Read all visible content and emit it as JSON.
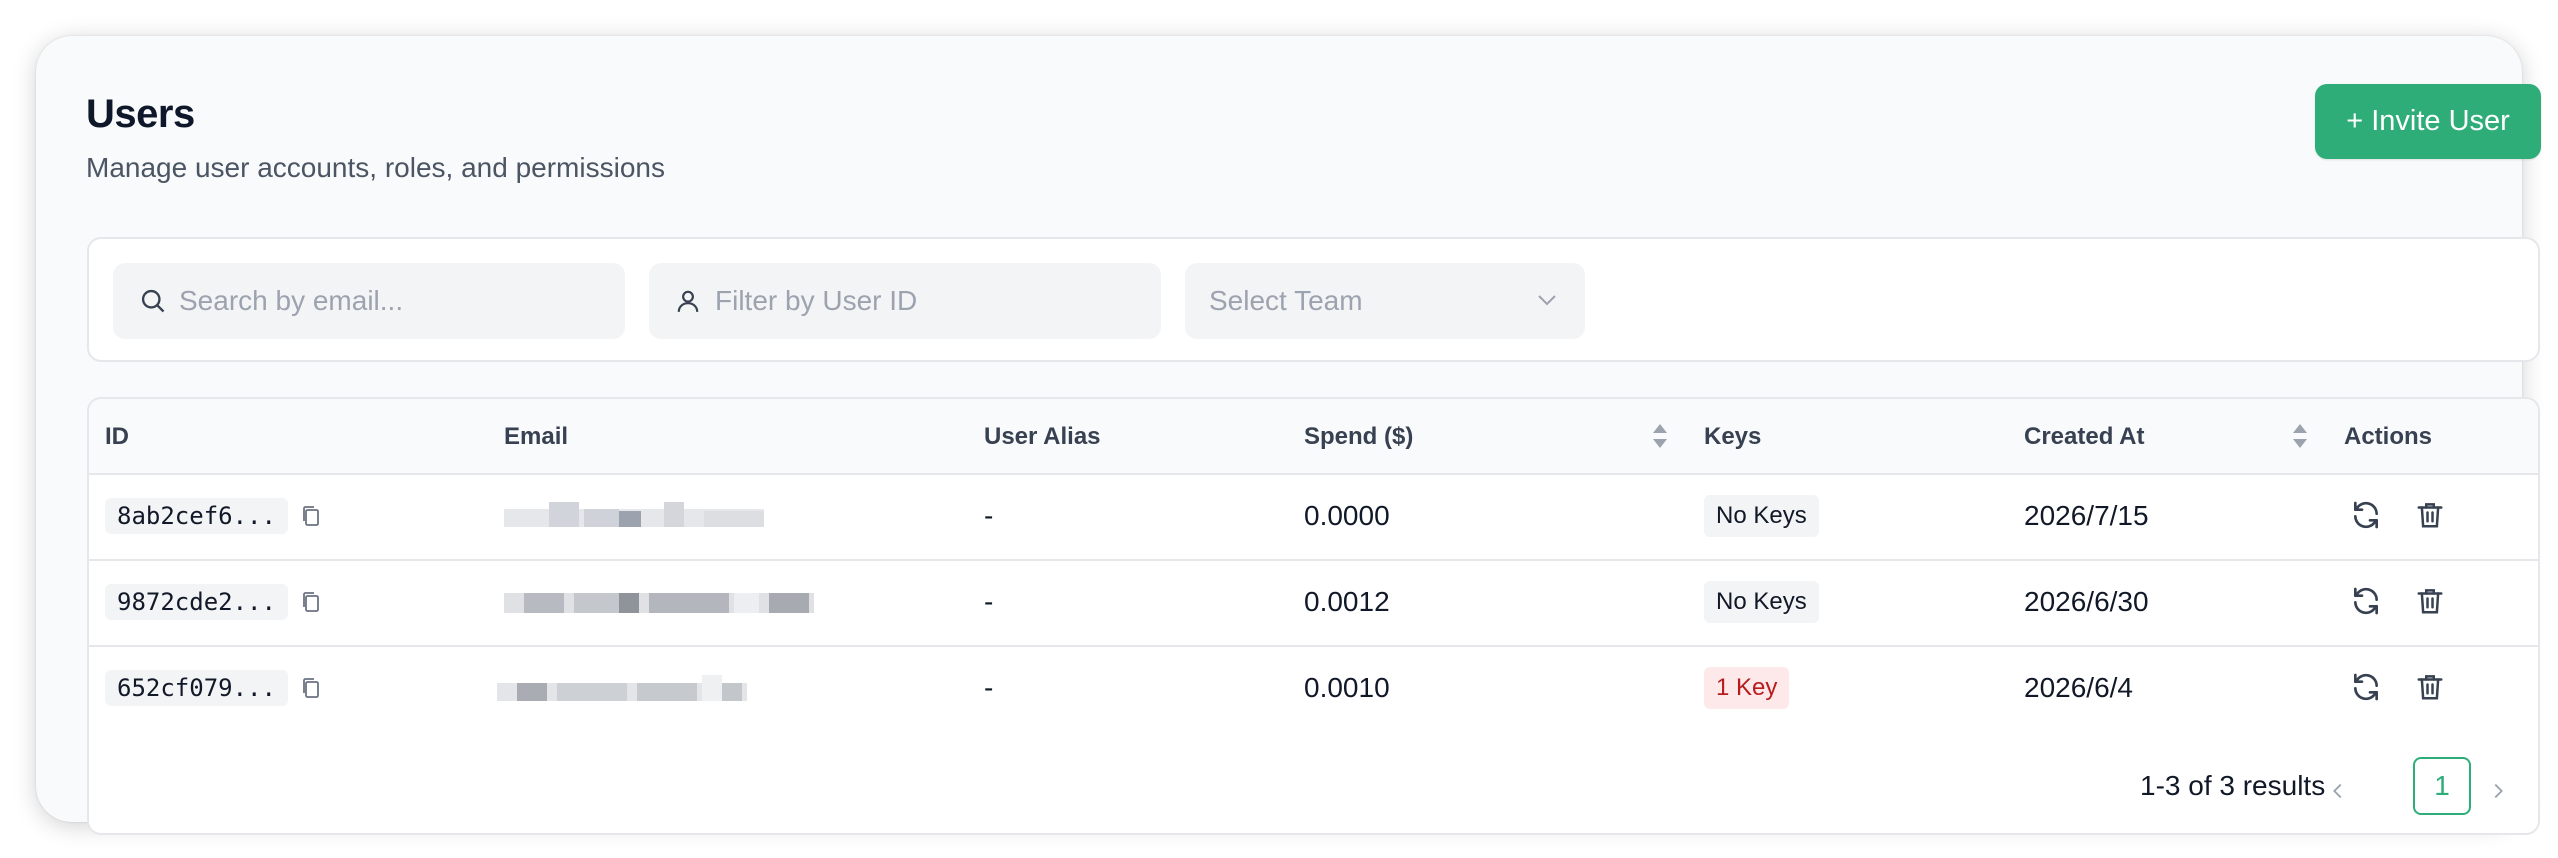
{
  "header": {
    "title": "Users",
    "subtitle": "Manage user accounts, roles, and permissions",
    "invite_label": "+ Invite User"
  },
  "filters": {
    "search_placeholder": "Search by email...",
    "user_id_placeholder": "Filter by User ID",
    "team_placeholder": "Select Team"
  },
  "table": {
    "columns": [
      "ID",
      "Email",
      "User Alias",
      "Spend ($)",
      "Keys",
      "Created At",
      "Actions"
    ],
    "rows": [
      {
        "id": "8ab2cef6...",
        "email": "",
        "alias": "-",
        "spend": "0.0000",
        "keys": "No Keys",
        "created": "2026/7/15"
      },
      {
        "id": "9872cde2...",
        "email": "",
        "alias": "-",
        "spend": "0.0012",
        "keys": "No Keys",
        "created": "2026/6/30"
      },
      {
        "id": "652cf079...",
        "email": "",
        "alias": "-",
        "spend": "0.0010",
        "keys": "1 Key",
        "created": "2026/6/4"
      }
    ]
  },
  "pagination": {
    "summary": "1-3 of 3 results",
    "current_page": "1"
  },
  "colors": {
    "accent": "#2ead79",
    "key_badge_bg": "#fde8ea",
    "key_badge_text": "#b91c1c"
  },
  "icons": [
    "search-icon",
    "user-icon",
    "chevron-down-icon",
    "sort-icon",
    "copy-icon",
    "refresh-icon",
    "trash-icon",
    "chevron-left-icon",
    "chevron-right-icon"
  ]
}
